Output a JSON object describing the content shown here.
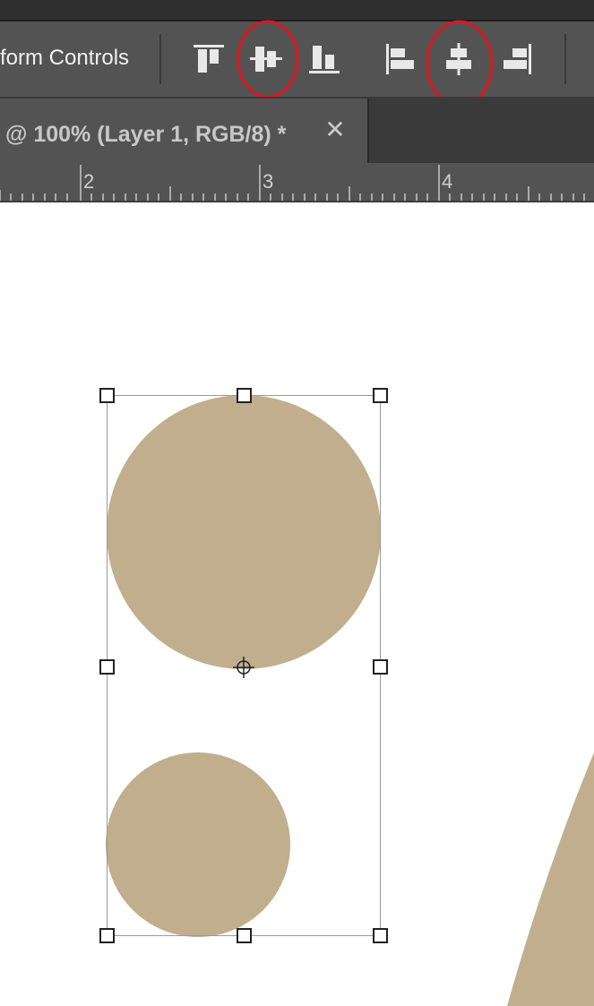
{
  "options_bar": {
    "transform_label": "form Controls"
  },
  "align_buttons": [
    {
      "name": "align-top-edges",
      "highlighted": false
    },
    {
      "name": "align-vertical-centers",
      "highlighted": true
    },
    {
      "name": "align-bottom-edges",
      "highlighted": false
    },
    {
      "name": "align-left-edges",
      "highlighted": false
    },
    {
      "name": "align-horizontal-centers",
      "highlighted": true
    },
    {
      "name": "align-right-edges",
      "highlighted": false
    }
  ],
  "document_tab": {
    "title": "@ 100% (Layer 1, RGB/8) *",
    "close_glyph": "✕"
  },
  "ruler": {
    "labels": [
      "2",
      "3",
      "4"
    ]
  },
  "colors": {
    "shape_fill": "#c0ae8d",
    "highlight": "#e0141e",
    "panel": "#535353",
    "icon": "#e8e8e8"
  }
}
